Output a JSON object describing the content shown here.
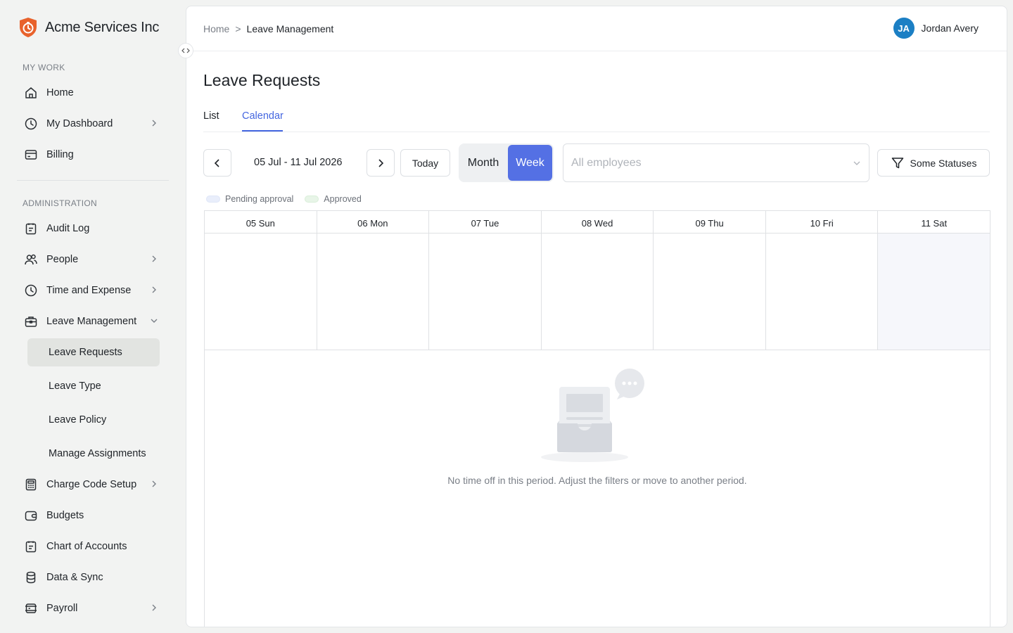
{
  "brand": {
    "name": "Acme Services Inc"
  },
  "sidebar": {
    "my_work_label": "MY WORK",
    "admin_label": "ADMINISTRATION",
    "my_work": [
      {
        "label": "Home",
        "icon": "home-icon"
      },
      {
        "label": "My Dashboard",
        "icon": "clock-icon",
        "expandable": true
      },
      {
        "label": "Billing",
        "icon": "billing-icon"
      }
    ],
    "admin": [
      {
        "label": "Audit Log",
        "icon": "audit-log-icon"
      },
      {
        "label": "People",
        "icon": "people-icon",
        "expandable": true
      },
      {
        "label": "Time and Expense",
        "icon": "clock-icon",
        "expandable": true
      },
      {
        "label": "Leave Management",
        "icon": "briefcase-icon",
        "expanded": true
      },
      {
        "label": "Charge Code Setup",
        "icon": "calculator-icon",
        "expandable": true
      },
      {
        "label": "Budgets",
        "icon": "wallet-icon"
      },
      {
        "label": "Chart of Accounts",
        "icon": "ledger-icon"
      },
      {
        "label": "Data & Sync",
        "icon": "database-icon"
      },
      {
        "label": "Payroll",
        "icon": "payroll-icon",
        "expandable": true
      }
    ],
    "leave_sub": [
      {
        "label": "Leave Requests",
        "active": true
      },
      {
        "label": "Leave Type"
      },
      {
        "label": "Leave Policy"
      },
      {
        "label": "Manage Assignments"
      }
    ]
  },
  "header": {
    "breadcrumb_home": "Home",
    "breadcrumb_sep": ">",
    "breadcrumb_current": "Leave Management",
    "user_initials": "JA",
    "user_name": "Jordan Avery"
  },
  "page": {
    "title": "Leave Requests",
    "tabs": [
      "List",
      "Calendar"
    ],
    "active_tab": "Calendar"
  },
  "toolbar": {
    "date_range": "05 Jul - 11 Jul 2026",
    "today_label": "Today",
    "view_month": "Month",
    "view_week": "Week",
    "active_view": "Week",
    "employees_placeholder": "All employees",
    "status_filter_label": "Some Statuses"
  },
  "legend": [
    {
      "label": "Pending approval",
      "color": "#e9eefb"
    },
    {
      "label": "Approved",
      "color": "#e8f5e8"
    }
  ],
  "calendar": {
    "days": [
      "05 Sun",
      "06 Mon",
      "07 Tue",
      "08 Wed",
      "09 Thu",
      "10 Fri",
      "11 Sat"
    ],
    "highlighted_day": "11 Sat"
  },
  "empty_state": {
    "message": "No time off in this period. Adjust the filters or move to another period."
  },
  "colors": {
    "accent": "#5470e4",
    "tab_active": "#4466e0",
    "brand_orange": "#e8622c",
    "avatar": "#1b7fc4"
  }
}
